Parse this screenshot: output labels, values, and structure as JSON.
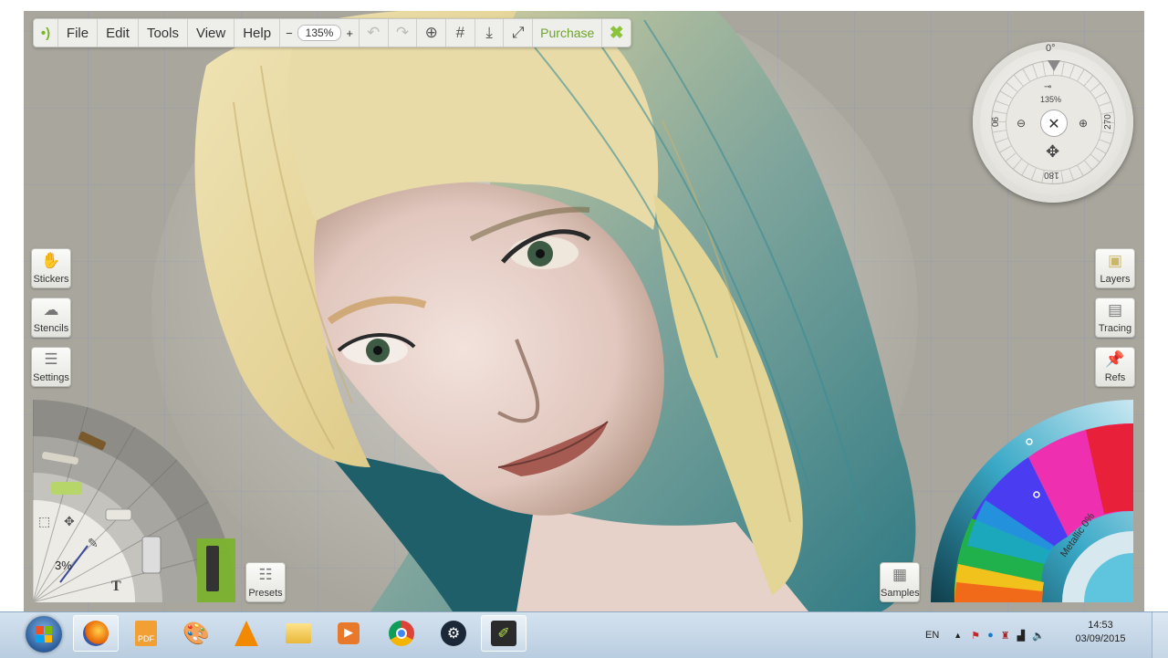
{
  "menu": {
    "file": "File",
    "edit": "Edit",
    "tools": "Tools",
    "view": "View",
    "help": "Help"
  },
  "toolbar": {
    "zoom_value": "135%",
    "zoom_minus": "−",
    "zoom_plus": "+",
    "purchase_label": "Purchase"
  },
  "compass": {
    "top_angle": "0°",
    "left_angle": "90",
    "right_angle": "270",
    "bottom_angle": "180",
    "zoom_value": "135%"
  },
  "left_buttons": {
    "stickers": "Stickers",
    "stencils": "Stencils",
    "settings": "Settings"
  },
  "right_buttons": {
    "layers": "Layers",
    "tracing": "Tracing",
    "refs": "Refs"
  },
  "tool_wheel": {
    "size_value": "3%",
    "text_tool": "T"
  },
  "presets_label": "Presets",
  "samples_label": "Samples",
  "color_wheel": {
    "metallic_label": "Metallic 0%"
  },
  "taskbar": {
    "language": "EN",
    "time": "14:53",
    "date": "03/09/2015"
  },
  "colors": {
    "accent_green": "#7ab52a",
    "canvas_bg": "#a9a79d",
    "toolbar_bg": "#eeeeea"
  }
}
